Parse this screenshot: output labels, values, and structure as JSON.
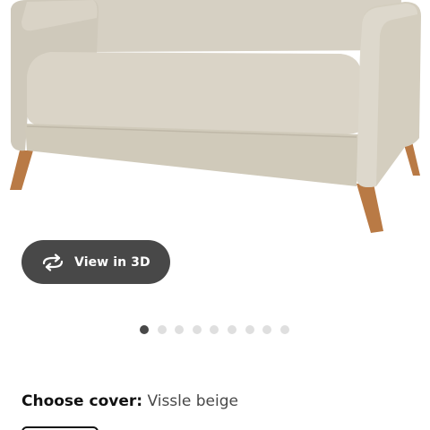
{
  "product": {
    "image_alt": "sofa-image"
  },
  "view3d": {
    "label": "View in 3D",
    "icon": "rotate-3d-icon"
  },
  "carousel": {
    "total": 9,
    "active_index": 0
  },
  "cover": {
    "label": "Choose cover:",
    "value": "Vissle beige"
  },
  "colors": {
    "button_bg": "#484848",
    "dot_active": "#484848",
    "dot_inactive": "#dfdfdf",
    "sofa_fabric": "#d3cdbf",
    "sofa_legs": "#b97a45"
  }
}
